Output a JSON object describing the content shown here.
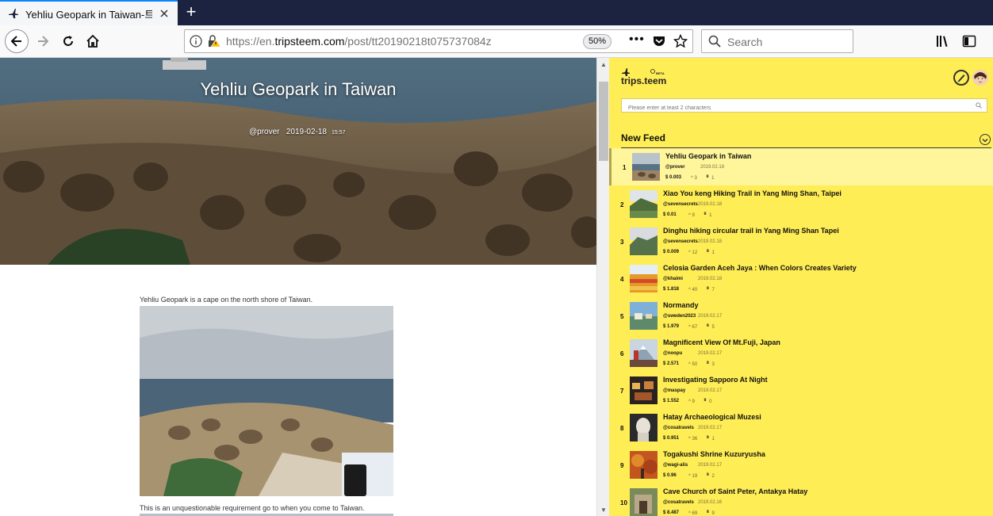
{
  "browser": {
    "tab_title": "Yehliu Geopark in Taiwan-트립",
    "url_prefix": "https://en.",
    "url_domain": "tripsteem.com",
    "url_path": "/post/tt20190218t075737084z",
    "zoom": "50%",
    "search_placeholder": "Search"
  },
  "post": {
    "title": "Yehliu Geopark in Taiwan",
    "author": "@prover",
    "date": "2019-02-18",
    "time": "15:57",
    "paragraph1": "Yehliu Geopark is a cape on the north shore of Taiwan.",
    "paragraph2": "This is an unquestionable requirement go to when you come to Taiwan."
  },
  "sidebar": {
    "search_placeholder": "Please enter at least 2 characters",
    "feed_title": "New Feed",
    "accent_color": "#ffed55",
    "items": [
      {
        "num": "1",
        "title": "Yehliu Geopark in Taiwan",
        "author": "@prover",
        "date": "2019.02.18",
        "price": "$ 0.003",
        "votes": "3",
        "comments": "1"
      },
      {
        "num": "2",
        "title": "Xiao You keng Hiking Trail in Yang Ming Shan, Taipei",
        "author": "@sevensecrets",
        "date": "2019.02.18",
        "price": "$ 0.01",
        "votes": "9",
        "comments": "1"
      },
      {
        "num": "3",
        "title": "Dinghu hiking circular trail in Yang Ming Shan Tapei",
        "author": "@sevensecrets",
        "date": "2019.02.18",
        "price": "$ 0.009",
        "votes": "12",
        "comments": "1"
      },
      {
        "num": "4",
        "title": "Celosia Garden Aceh Jaya : When Colors Creates Variety",
        "author": "@khaimi",
        "date": "2019.02.18",
        "price": "$ 1.818",
        "votes": "40",
        "comments": "7"
      },
      {
        "num": "5",
        "title": "Normandy",
        "author": "@sweden2023",
        "date": "2019.02.17",
        "price": "$ 1.979",
        "votes": "67",
        "comments": "5"
      },
      {
        "num": "6",
        "title": "Magnificent View Of Mt.Fuji, Japan",
        "author": "@noopu",
        "date": "2019.02.17",
        "price": "$ 2.571",
        "votes": "50",
        "comments": "3"
      },
      {
        "num": "7",
        "title": "Investigating Sapporo At Night",
        "author": "@maspay",
        "date": "2019.02.17",
        "price": "$ 1.552",
        "votes": "9",
        "comments": "0"
      },
      {
        "num": "8",
        "title": "Hatay Archaeological Muzesi",
        "author": "@cosatravels",
        "date": "2019.02.17",
        "price": "$ 0.951",
        "votes": "36",
        "comments": "1"
      },
      {
        "num": "9",
        "title": "Togakushi Shrine Kuzuryusha",
        "author": "@wagi-alis",
        "date": "2019.02.17",
        "price": "$ 0.96",
        "votes": "19",
        "comments": "2"
      },
      {
        "num": "10",
        "title": "Cave Church of Saint Peter, Antakya Hatay",
        "author": "@cosatravels",
        "date": "2019.02.16",
        "price": "$ 8.487",
        "votes": "69",
        "comments": "9"
      }
    ]
  }
}
